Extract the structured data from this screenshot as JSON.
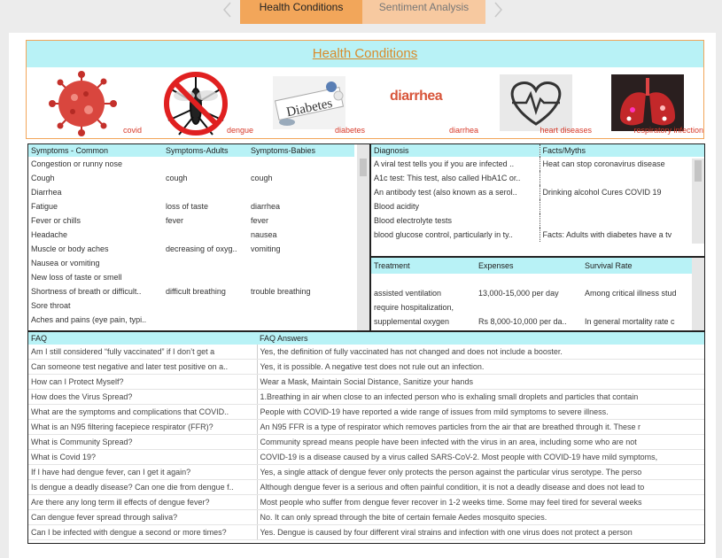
{
  "tabs": [
    {
      "label": "Health Conditions",
      "active": true
    },
    {
      "label": "Sentiment Analysis",
      "active": false
    }
  ],
  "nav": {
    "prev_icon": "chevron-left-icon",
    "next_icon": "chevron-right-icon"
  },
  "banner": {
    "title": "Health Conditions",
    "images": [
      {
        "caption": "covid",
        "icon": "virus-icon"
      },
      {
        "caption": "dengue",
        "icon": "no-mosquito-icon"
      },
      {
        "caption": "diabetes",
        "icon": "diabetes-pills-icon"
      },
      {
        "caption": "diarrhea",
        "icon": "diarrhea-text-icon",
        "image_text": "diarrhea"
      },
      {
        "caption": "heart diseases",
        "icon": "heart-pulse-icon"
      },
      {
        "caption": "respiratory infection",
        "icon": "lungs-icon"
      }
    ]
  },
  "symptoms": {
    "headers": [
      "Symptoms - Common",
      "Symptoms-Adults",
      "Symptoms-Babies"
    ],
    "rows": [
      [
        "Congestion or runny nose",
        "",
        ""
      ],
      [
        "Cough",
        "cough",
        "cough"
      ],
      [
        "Diarrhea",
        "",
        ""
      ],
      [
        "Fatigue",
        "loss of taste",
        "diarrhea"
      ],
      [
        "Fever or chills",
        "fever",
        "fever"
      ],
      [
        "Headache",
        "",
        "nausea"
      ],
      [
        "Muscle or body aches",
        "decreasing of oxyg..",
        "vomiting"
      ],
      [
        "Nausea or vomiting",
        "",
        ""
      ],
      [
        "New loss of taste or smell",
        "",
        ""
      ],
      [
        "Shortness of breath or difficult..",
        "difficult breathing",
        "trouble breathing"
      ],
      [
        "Sore throat",
        "",
        ""
      ],
      [
        "Aches and pains (eye pain, typi..",
        "",
        ""
      ]
    ]
  },
  "diagnosis": {
    "headers": [
      "Diagnosis",
      "Facts/Myths"
    ],
    "rows": [
      [
        "A viral test tells you if you are infected ..",
        "Heat can stop coronavirus disease"
      ],
      [
        "A1c test: This test, also called HbA1C or..",
        ""
      ],
      [
        "An antibody test (also known as a serol..",
        "Drinking alcohol Cures COVID 19"
      ],
      [
        "Blood acidity",
        ""
      ],
      [
        "Blood electrolyte tests",
        ""
      ],
      [
        "blood glucose control, particularly in ty..",
        "Facts: Adults with diabetes have a tv"
      ]
    ]
  },
  "treatment": {
    "headers": [
      "Treatment",
      "Expenses",
      "Survival Rate"
    ],
    "rows": [
      [
        "assisted ventilation",
        "13,000-15,000 per day",
        "Among critical illness stud"
      ],
      [
        "require hospitalization,",
        "",
        ""
      ],
      [
        "supplemental oxygen",
        "Rs 8,000-10,000 per da..",
        "In general mortality rate c"
      ]
    ]
  },
  "faq": {
    "headers": [
      "FAQ",
      "FAQ Answers"
    ],
    "rows": [
      [
        "Am I still considered “fully vaccinated” if I don’t get a",
        "Yes, the definition of fully vaccinated has not changed and does not include a booster."
      ],
      [
        "Can someone test negative and later test positive on a..",
        "Yes, it is possible. A negative test does not rule out an infection."
      ],
      [
        "How can I Protect Myself?",
        "Wear a Mask, Maintain Social Distance, Sanitize your hands"
      ],
      [
        "How does the Virus Spread?",
        "1.Breathing in air when close to an infected person who is exhaling small droplets and particles that contain"
      ],
      [
        "What are the symptoms and complications that COVID..",
        "People with COVID-19 have reported a wide range of issues from mild symptoms to severe illness."
      ],
      [
        "What is an N95 filtering facepiece respirator (FFR)?",
        "An N95 FFR is a type of respirator which removes particles from the air that are breathed through it. These r"
      ],
      [
        "What is Community Spread?",
        "Community spread means people have been infected with the virus in an area, including some who are not"
      ],
      [
        "What is Covid 19?",
        "COVID-19 is a disease caused by a virus called SARS-CoV-2. Most people with COVID-19 have mild symptoms,"
      ],
      [
        " If I have had dengue fever, can I get it again?",
        "Yes, a single attack of dengue fever only protects the person against the particular virus serotype. The perso"
      ],
      [
        " Is dengue a deadly disease? Can one die from dengue f..",
        "Although dengue fever is a serious and often painful condition, it is not a deadly disease and does not lead to"
      ],
      [
        "Are there any long term ill effects of dengue fever?",
        "Most people who suffer from dengue fever recover in 1-2 weeks time. Some may feel tired for several weeks"
      ],
      [
        "Can dengue fever spread through saliva?",
        "No. It can only spread through the bite of certain female Aedes mosquito species."
      ],
      [
        "Can I be infected with dengue a second or more times?",
        "Yes. Dengue is caused by four different viral strains and infection with one virus does not protect a person"
      ]
    ]
  },
  "colors": {
    "header_bg": "#b8f2f6",
    "tab_active": "#f2a65a",
    "tab_inactive": "#f7c9a0",
    "title_text": "#d98a2b",
    "caption_text": "#d83a2a"
  }
}
